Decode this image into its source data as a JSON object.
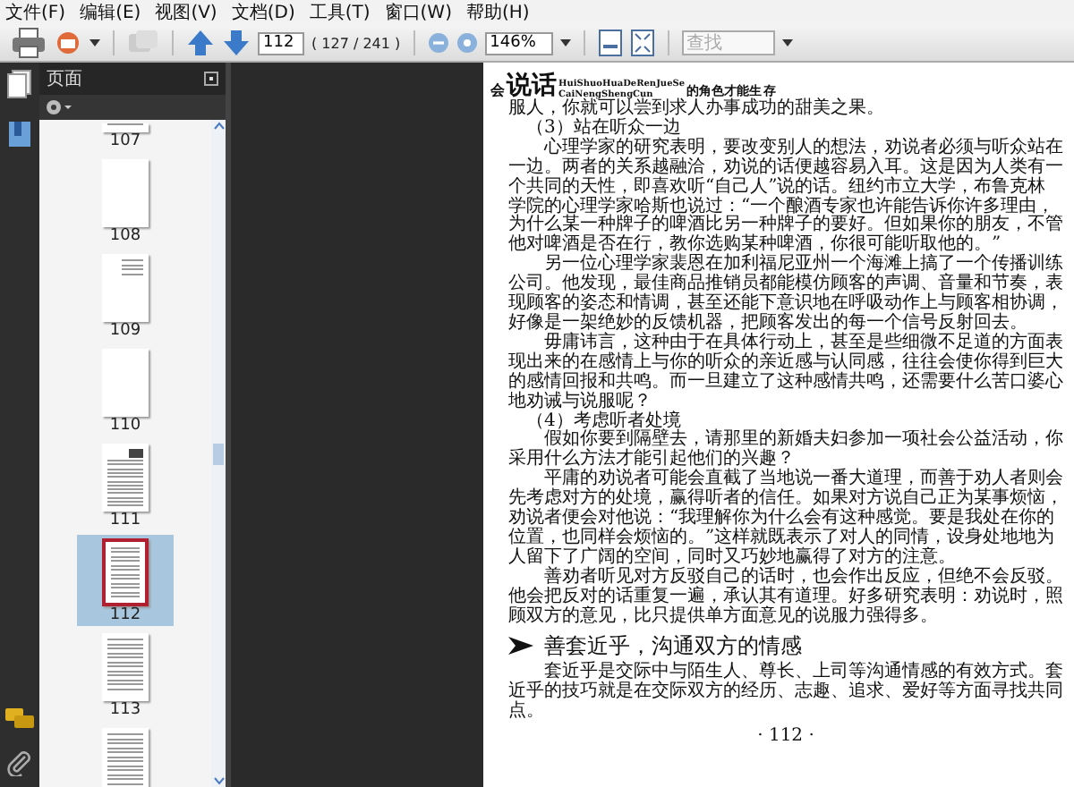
{
  "menu": [
    {
      "label": "文件(F)"
    },
    {
      "label": "编辑(E)"
    },
    {
      "label": "视图(V)"
    },
    {
      "label": "文档(D)"
    },
    {
      "label": "工具(T)"
    },
    {
      "label": "窗口(W)"
    },
    {
      "label": "帮助(H)"
    }
  ],
  "toolbar": {
    "page_field": "112",
    "page_count": "( 127 / 241 )",
    "zoom_field": "146%",
    "search": {
      "placeholder": "查找"
    }
  },
  "sidebar": {
    "title": "页面",
    "thumbnails": [
      {
        "label": "107",
        "kind": "cut",
        "selected": false
      },
      {
        "label": "108",
        "kind": "blank",
        "selected": false
      },
      {
        "label": "109",
        "kind": "sparse",
        "selected": false
      },
      {
        "label": "110",
        "kind": "blank",
        "selected": false
      },
      {
        "label": "111",
        "kind": "figure",
        "selected": false
      },
      {
        "label": "112",
        "kind": "text",
        "selected": true
      },
      {
        "label": "113",
        "kind": "text",
        "selected": false
      },
      {
        "kind": "text",
        "selected": false
      }
    ]
  },
  "document": {
    "header": {
      "small": "会",
      "title": "说话",
      "roman_top": "HuiShuoHuaDeRenJueSe",
      "roman_bottom": "CaiNengShengCun",
      "subtitle": "的角色才能生",
      "subtitle_end": "存"
    },
    "blocks": [
      {
        "kind": "lead",
        "text": "服人，你就可以尝到求人办事成功的甜美之果。"
      },
      {
        "kind": "subheading",
        "text": "（3）站在听众一边"
      },
      {
        "kind": "body",
        "text": "心理学家的研究表明，要改变别人的想法，劝说者必须与听众站在一边。两者的关系越融洽，劝说的话便越容易入耳。这是因为人类有一个共同的天性，即喜欢听“自己人”说的话。纽约市立大学，布鲁克林学院的心理学家哈斯也说过：“一个酿酒专家也许能告诉你许多理由，为什么某一种牌子的啤酒比另一种牌子的要好。但如果你的朋友，不管他对啤酒是否在行，教你选购某种啤酒，你很可能听取他的。”"
      },
      {
        "kind": "body",
        "text": "另一位心理学家裴恩在加利福尼亚州一个海滩上搞了一个传播训练公司。他发现，最佳商品推销员都能模仿顾客的声调、音量和节奏，表现顾客的姿态和情调，甚至还能下意识地在呼吸动作上与顾客相协调，好像是一架绝妙的反馈机器，把顾客发出的每一个信号反射回去。"
      },
      {
        "kind": "body",
        "text": "毋庸讳言，这种由于在具体行动上，甚至是些细微不足道的方面表现出来的在感情上与你的听众的亲近感与认同感，往往会使你得到巨大的感情回报和共鸣。而一旦建立了这种感情共鸣，还需要什么苦口婆心地劝诫与说服呢？"
      },
      {
        "kind": "subheading",
        "text": "（4）考虑听者处境"
      },
      {
        "kind": "body",
        "text": "假如你要到隔壁去，请那里的新婚夫妇参加一项社会公益活动，你采用什么方法才能引起他们的兴趣？"
      },
      {
        "kind": "body",
        "text": "平庸的劝说者可能会直截了当地说一番大道理，而善于劝人者则会先考虑对方的处境，赢得听者的信任。如果对方说自己正为某事烦恼，劝说者便会对他说：“我理解你为什么会有这种感觉。要是我处在你的位置，也同样会烦恼的。”这样就既表示了对人的同情，设身处地地为人留下了广阔的空间，同时又巧妙地赢得了对方的注意。"
      },
      {
        "kind": "body",
        "text": "善劝者听见对方反驳自己的话时，也会作出反应，但绝不会反驳。他会把反对的话重复一遍，承认其有道理。好多研究表明：劝说时，照顾双方的意见，比只提供单方面意见的说服力强得多。"
      },
      {
        "kind": "heading",
        "text": "善套近乎，沟通双方的情感"
      },
      {
        "kind": "body",
        "text": "套近乎是交际中与陌生人、尊长、上司等沟通情感的有效方式。套近乎的技巧就是在交际双方的经历、志趣、追求、爱好等方面寻找共同点。"
      },
      {
        "kind": "page_number",
        "text": "· 112 ·"
      }
    ]
  }
}
